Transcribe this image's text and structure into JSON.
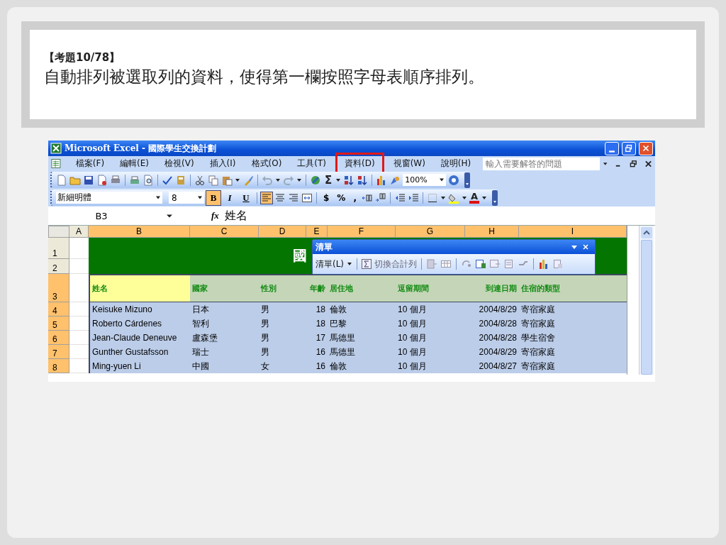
{
  "slide": {
    "question_number": "【考題10/78】",
    "question": "自動排列被選取列的資料，使得第一欄按照字母表順序排列。"
  },
  "excel": {
    "title": "Microsoft Excel - 國際學生交換計劃",
    "menu": [
      {
        "label": "檔案(F)",
        "highlighted": false
      },
      {
        "label": "編輯(E)",
        "highlighted": false
      },
      {
        "label": "檢視(V)",
        "highlighted": false
      },
      {
        "label": "插入(I)",
        "highlighted": false
      },
      {
        "label": "格式(O)",
        "highlighted": false
      },
      {
        "label": "工具(T)",
        "highlighted": false
      },
      {
        "label": "資料(D)",
        "highlighted": true
      },
      {
        "label": "視窗(W)",
        "highlighted": false
      },
      {
        "label": "說明(H)",
        "highlighted": false
      }
    ],
    "help_placeholder": "輸入需要解答的問題",
    "sum_symbol": "Σ",
    "zoom": "100%",
    "font": "新細明體",
    "font_size": "8",
    "format_buttons": [
      {
        "label": "B",
        "active": true
      },
      {
        "label": "I",
        "active": false
      },
      {
        "label": "U",
        "active": false
      }
    ],
    "alignment": [
      {
        "kind": "left",
        "active": true
      },
      {
        "kind": "center",
        "active": false
      },
      {
        "kind": "right",
        "active": false
      },
      {
        "kind": "merge",
        "active": false
      }
    ],
    "number_buttons": [
      "$",
      "%",
      ","
    ],
    "font_color_label": "A",
    "name_box": "B3",
    "function_label": "fx",
    "formula": "姓名",
    "columns": [
      {
        "label": "A",
        "selected": false
      },
      {
        "label": "B",
        "selected": true
      },
      {
        "label": "C",
        "selected": true
      },
      {
        "label": "D",
        "selected": true
      },
      {
        "label": "E",
        "selected": true
      },
      {
        "label": "F",
        "selected": true
      },
      {
        "label": "G",
        "selected": true
      },
      {
        "label": "H",
        "selected": true
      },
      {
        "label": "I",
        "selected": true
      }
    ],
    "row_numbers": [
      {
        "label": "1",
        "selected": false
      },
      {
        "label": "2",
        "selected": false
      },
      {
        "label": "3",
        "selected": true
      },
      {
        "label": "4",
        "selected": true
      },
      {
        "label": "5",
        "selected": true
      },
      {
        "label": "6",
        "selected": true
      },
      {
        "label": "7",
        "selected": true
      },
      {
        "label": "8",
        "selected": true
      }
    ],
    "banner": "國",
    "list_toolbar": {
      "title": "清單",
      "list_menu": "清單(L)",
      "toggle_total": "切換合計列"
    },
    "header": [
      {
        "text": "姓名",
        "highlighted": true
      },
      {
        "text": "國家",
        "highlighted": false
      },
      {
        "text": "性別",
        "highlighted": false
      },
      {
        "text": "年齡",
        "highlighted": false
      },
      {
        "text": "居住地",
        "highlighted": false
      },
      {
        "text": "逗留期間",
        "highlighted": false
      },
      {
        "text": "到達日期",
        "highlighted": false
      },
      {
        "text": "住宿的類型",
        "highlighted": false
      }
    ],
    "data": [
      [
        "Keisuke Mizuno",
        "日本",
        "男",
        "18",
        "倫敦",
        "10 個月",
        "2004/8/29",
        "寄宿家庭"
      ],
      [
        "Roberto Cárdenes",
        "智利",
        "男",
        "18",
        "巴黎",
        "10 個月",
        "2004/8/28",
        "寄宿家庭"
      ],
      [
        "Jean-Claude Deneuve",
        "盧森堡",
        "男",
        "17",
        "馬德里",
        "10 個月",
        "2004/8/28",
        "學生宿舍"
      ],
      [
        "Gunther Gustafsson",
        "瑞士",
        "男",
        "16",
        "馬德里",
        "10 個月",
        "2004/8/29",
        "寄宿家庭"
      ],
      [
        "Ming-yuen Li",
        "中國",
        "女",
        "16",
        "倫敦",
        "10 個月",
        "2004/8/27",
        "寄宿家庭"
      ]
    ]
  }
}
